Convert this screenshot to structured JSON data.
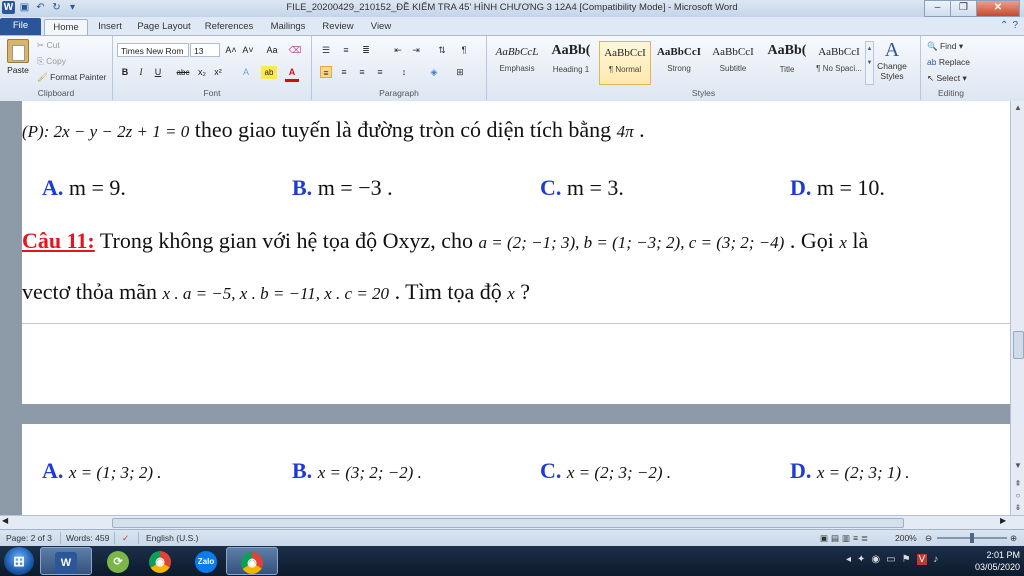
{
  "window": {
    "title": "FILE_20200429_210152_ĐỀ KIỂM TRA 45' HÌNH CHƯƠNG 3 12A4 [Compatibility Mode] - Microsoft Word",
    "app_letter": "W"
  },
  "qat": {
    "save": "▣",
    "undo": "↶",
    "redo": "↻",
    "more": "▾"
  },
  "tabs": [
    {
      "label": "File"
    },
    {
      "label": "Home"
    },
    {
      "label": "Insert"
    },
    {
      "label": "Page Layout"
    },
    {
      "label": "References"
    },
    {
      "label": "Mailings"
    },
    {
      "label": "Review"
    },
    {
      "label": "View"
    }
  ],
  "clipboard": {
    "group_label": "Clipboard",
    "paste": "Paste",
    "cut": "Cut",
    "copy": "Copy",
    "format_painter": "Format Painter"
  },
  "font": {
    "group_label": "Font",
    "name": "Times New Rom",
    "size": "13",
    "grow": "A˄",
    "shrink": "A˅",
    "change_case": "Aa",
    "clear_format": "⌫",
    "bold": "B",
    "italic": "I",
    "underline": "U",
    "strike": "abc",
    "subscript": "x₂",
    "superscript": "x²",
    "text_effects": "A",
    "highlight": "ab",
    "font_color": "A"
  },
  "paragraph": {
    "group_label": "Paragraph"
  },
  "styles": {
    "group_label": "Styles",
    "items": [
      {
        "preview": "AaBbCcL",
        "name": "Emphasis"
      },
      {
        "preview": "AaBb(",
        "name": "Heading 1"
      },
      {
        "preview": "AaBbCcI",
        "name": "¶ Normal"
      },
      {
        "preview": "AaBbCcI",
        "name": "Strong"
      },
      {
        "preview": "AaBbCcI",
        "name": "Subtitle"
      },
      {
        "preview": "AaBb(",
        "name": "Title"
      },
      {
        "preview": "AaBbCcI",
        "name": "¶ No Spaci..."
      }
    ],
    "change_styles": "Change Styles"
  },
  "editing": {
    "group_label": "Editing",
    "find": "Find",
    "replace": "Replace",
    "select": "Select"
  },
  "doc": {
    "line1_math": "(P): 2x − y − 2z + 1 = 0",
    "line1_text": " theo giao tuyến là đường tròn có diện tích bằng ",
    "line1_math2": "4π",
    "line1_end": " .",
    "ans1": [
      {
        "letter": "A.",
        "text": " m = 9."
      },
      {
        "letter": "B.",
        "text": " m = −3 ."
      },
      {
        "letter": "C.",
        "text": " m = 3."
      },
      {
        "letter": "D.",
        "text": " m = 10."
      }
    ],
    "q11_label": "Câu 11:",
    "q11_text": " Trong không gian với hệ tọa độ Oxyz, cho ",
    "q11_math": "a = (2; −1; 3), b = (1; −3; 2), c = (3; 2; −4)",
    "q11_text2": " . Gọi ",
    "q11_x": "x",
    "q11_end": " là",
    "q11_line2_text": "vectơ thỏa mãn ",
    "q11_line2_math": "x . a = −5,  x . b = −11,  x . c = 20",
    "q11_line2_text2": " . Tìm tọa độ ",
    "q11_line2_x": "x",
    "q11_line2_end": " ?",
    "ans2": [
      {
        "letter": "A.",
        "math": "x = (1; 3; 2) ."
      },
      {
        "letter": "B.",
        "math": "x = (3; 2; −2) ."
      },
      {
        "letter": "C.",
        "math": "x = (2; 3; −2) ."
      },
      {
        "letter": "D.",
        "math": "x = (2; 3; 1) ."
      }
    ]
  },
  "status": {
    "page": "Page: 2 of 3",
    "words": "Words: 459",
    "language": "English (U.S.)",
    "zoom": "200%"
  },
  "taskbar": {
    "start": "⊞",
    "apps": [
      {
        "name": "word",
        "label": "W"
      },
      {
        "name": "app2",
        "label": "⟳"
      },
      {
        "name": "chrome",
        "label": "◉"
      },
      {
        "name": "zalo",
        "label": "Zalo"
      },
      {
        "name": "chrome2",
        "label": "◉"
      }
    ],
    "time": "2:01 PM",
    "date": "03/05/2020"
  }
}
